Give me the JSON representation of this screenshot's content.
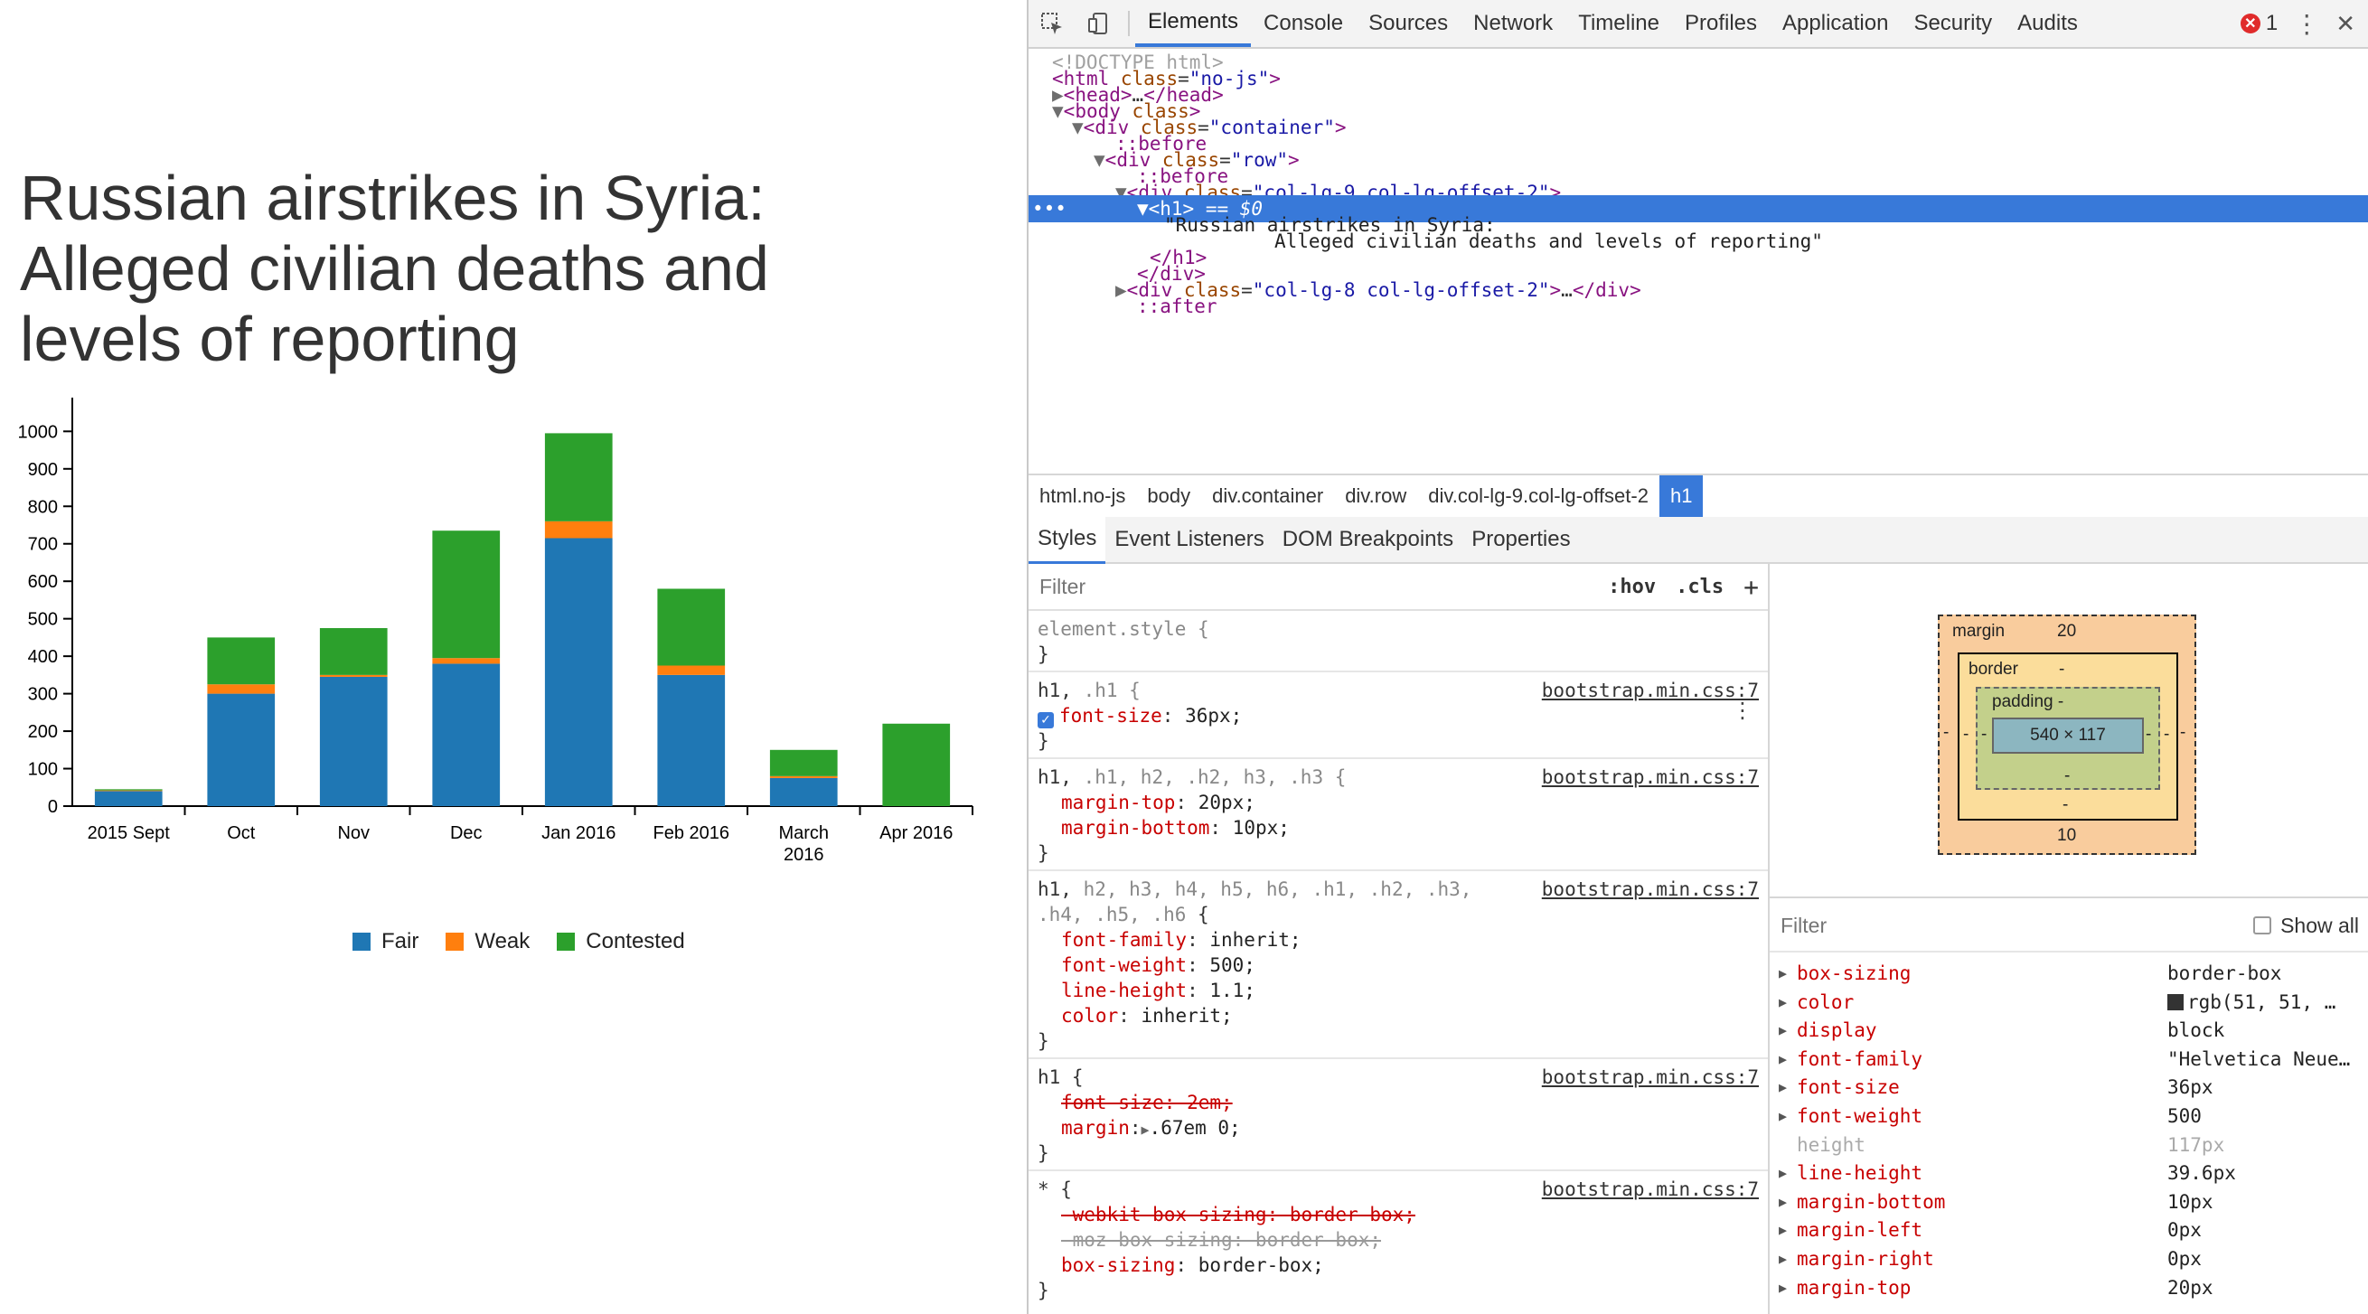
{
  "page": {
    "title": "Russian airstrikes in Syria: Alleged civilian deaths and levels of reporting"
  },
  "chart_data": {
    "type": "bar",
    "stacked": true,
    "categories": [
      "2015 Sept",
      "Oct",
      "Nov",
      "Dec",
      "Jan 2016",
      "Feb 2016",
      "March 2016",
      "Apr 2016"
    ],
    "series": [
      {
        "name": "Fair",
        "color": "#1f77b4",
        "values": [
          40,
          300,
          345,
          380,
          715,
          350,
          75,
          0
        ]
      },
      {
        "name": "Weak",
        "color": "#ff7f0e",
        "values": [
          2,
          25,
          5,
          15,
          45,
          25,
          5,
          0
        ]
      },
      {
        "name": "Contested",
        "color": "#2ca02c",
        "values": [
          3,
          125,
          125,
          340,
          235,
          205,
          70,
          220
        ]
      }
    ],
    "yticks": [
      0,
      100,
      200,
      300,
      400,
      500,
      600,
      700,
      800,
      900,
      1000
    ],
    "ylim": [
      0,
      1090
    ],
    "legend_position": "bottom",
    "grid": false
  },
  "devtools": {
    "tabs": [
      "Elements",
      "Console",
      "Sources",
      "Network",
      "Timeline",
      "Profiles",
      "Application",
      "Security",
      "Audits"
    ],
    "active_tab": "Elements",
    "error_count": "1",
    "dom": {
      "doctype": "<!DOCTYPE html>",
      "html_tag": "html",
      "html_attr": "class",
      "html_val": "\"no-js\"",
      "head": "head",
      "head_ellipsis": "…",
      "body": "body",
      "body_attr": "class",
      "div": "div",
      "class_attr": "class",
      "container": "\"container\"",
      "before": "::before",
      "row": "\"row\"",
      "col9": "\"col-lg-9 col-lg-offset-2\"",
      "h1": "h1",
      "h1_marker": "== $0",
      "dots": "•••",
      "text_line1": "\"Russian airstrikes in Syria:",
      "text_line2": "Alleged civilian deaths and levels of reporting\"",
      "close_h1": "/h1",
      "close_div": "/div",
      "col8": "\"col-lg-8 col-lg-offset-2\"",
      "ellipsis": "…",
      "after": "::after"
    },
    "breadcrumbs": [
      "html.no-js",
      "body",
      "div.container",
      "div.row",
      "div.col-lg-9.col-lg-offset-2",
      "h1"
    ],
    "subtabs": [
      "Styles",
      "Event Listeners",
      "DOM Breakpoints",
      "Properties"
    ],
    "styles": {
      "filter_placeholder": "Filter",
      "hov": ":hov",
      "cls": ".cls",
      "plus": "+",
      "element_style": "element.style {",
      "close": "}",
      "rule1_sel_a": "h1,",
      "rule1_sel_b": " .h1 {",
      "rule1_src": "bootstrap.min.css:7",
      "rule1_prop": "font-size",
      "rule1_val": "36px;",
      "rule2_sel_a": "h1,",
      "rule2_sel_b": " .h1, h2, .h2, h3, .h3 {",
      "rule2_src": "bootstrap.min.css:7",
      "rule2_p1": "margin-top",
      "rule2_v1": "20px;",
      "rule2_p2": "margin-bottom",
      "rule2_v2": "10px;",
      "rule3_sel_a": "h1,",
      "rule3_sel_b": " h2, h3, h4, h5, h6, .h1, .h2, .h3,",
      "rule3_sel_c": ".h4, .h5, .h6",
      "rule3_sel_d": " {",
      "rule3_src": "bootstrap.min.css:7",
      "rule3_p1": "font-family",
      "rule3_v1": "inherit;",
      "rule3_p2": "font-weight",
      "rule3_v2": "500;",
      "rule3_p3": "line-height",
      "rule3_v3": "1.1;",
      "rule3_p4": "color",
      "rule3_v4": "inherit;",
      "rule4_sel": "h1 {",
      "rule4_src": "bootstrap.min.css:7",
      "rule4_p1": "font-size: 2em;",
      "rule4_p2": "margin",
      "rule4_v2": ".67em 0;",
      "rule5_sel": "* {",
      "rule5_src": "bootstrap.min.css:7",
      "rule5_p1": "-webkit-box-sizing: border-box;",
      "rule5_p2": "-moz-box-sizing: border-box;",
      "rule5_p3": "box-sizing",
      "rule5_v3": "border-box;"
    },
    "box_model": {
      "margin_label": "margin",
      "margin_top": "20",
      "margin_bottom": "10",
      "margin_left": "-",
      "margin_right": "-",
      "border_label": "border",
      "border_value": "-",
      "border_bottom": "-",
      "border_left": "-",
      "border_right": "-",
      "padding_label": "padding -",
      "padding_bottom": "-",
      "padding_left": "-",
      "padding_right": "-",
      "content": "540 × 117"
    },
    "computed": {
      "filter_placeholder": "Filter",
      "show_all": "Show all",
      "rows": [
        {
          "name": "box-sizing",
          "value": "border-box"
        },
        {
          "name": "color",
          "value": "rgb(51, 51, …"
        },
        {
          "name": "display",
          "value": "block"
        },
        {
          "name": "font-family",
          "value": "\"Helvetica Neue…"
        },
        {
          "name": "font-size",
          "value": "36px"
        },
        {
          "name": "font-weight",
          "value": "500"
        },
        {
          "name": "height",
          "value": "117px"
        },
        {
          "name": "line-height",
          "value": "39.6px"
        },
        {
          "name": "margin-bottom",
          "value": "10px"
        },
        {
          "name": "margin-left",
          "value": "0px"
        },
        {
          "name": "margin-right",
          "value": "0px"
        },
        {
          "name": "margin-top",
          "value": "20px"
        }
      ]
    }
  }
}
